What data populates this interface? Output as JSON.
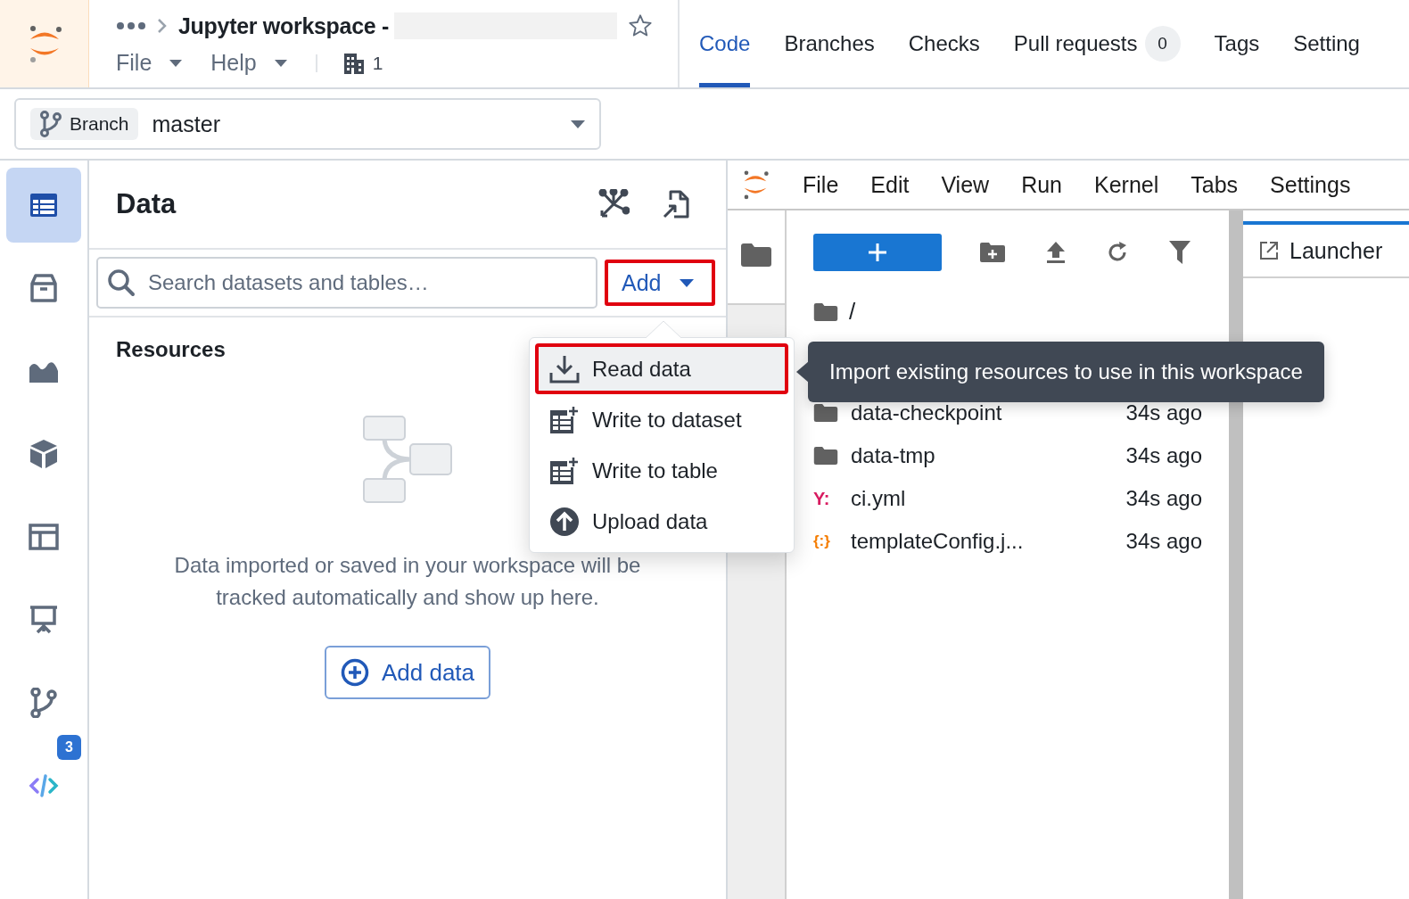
{
  "header": {
    "title": "Jupyter workspace -",
    "starred": false,
    "menus": [
      "File",
      "Help"
    ],
    "building_count": "1"
  },
  "repo_tabs": [
    {
      "label": "Code",
      "selected": true
    },
    {
      "label": "Branches",
      "selected": false
    },
    {
      "label": "Checks",
      "selected": false
    },
    {
      "label": "Pull requests",
      "count": "0",
      "selected": false
    },
    {
      "label": "Tags",
      "selected": false
    },
    {
      "label": "Setting",
      "selected": false
    }
  ],
  "branch": {
    "label": "Branch",
    "value": "master"
  },
  "sidebar": [
    {
      "kind": "table",
      "selected": true
    },
    {
      "kind": "box",
      "selected": false
    },
    {
      "kind": "area",
      "selected": false
    },
    {
      "kind": "cube",
      "selected": false
    },
    {
      "kind": "layout",
      "selected": false
    },
    {
      "kind": "presentation",
      "selected": false
    },
    {
      "kind": "branch",
      "selected": false,
      "badge": "3"
    },
    {
      "kind": "code",
      "selected": false
    }
  ],
  "data_panel": {
    "title": "Data",
    "search": {
      "placeholder": "Search datasets and tables…"
    },
    "add_button": {
      "label": "Add",
      "highlighted": true
    },
    "section": "Resources",
    "empty_message": "Data imported or saved in your workspace will be tracked automatically and show up here.",
    "add_data_button": "Add data"
  },
  "add_menu": [
    {
      "kind": "download",
      "label": "Read data",
      "highlighted": true
    },
    {
      "kind": "table-add",
      "label": "Write to dataset",
      "highlighted": false
    },
    {
      "kind": "table-add",
      "label": "Write to table",
      "highlighted": false
    },
    {
      "kind": "upload",
      "label": "Upload data",
      "highlighted": false
    }
  ],
  "tooltip": "Import existing resources to use in this workspace",
  "jupyter": {
    "menus": [
      "File",
      "Edit",
      "View",
      "Run",
      "Kernel",
      "Tabs",
      "Settings"
    ],
    "path": "/",
    "files": [
      {
        "kind": "folder",
        "name": "data-checkpoint",
        "modified": "34s ago"
      },
      {
        "kind": "folder",
        "name": "data-tmp",
        "modified": "34s ago"
      },
      {
        "kind": "yaml",
        "icon_text": "Y:",
        "name": "ci.yml",
        "modified": "34s ago"
      },
      {
        "kind": "json",
        "icon_text": "{:}",
        "name": "templateConfig.j...",
        "modified": "34s ago"
      }
    ],
    "launcher_tab": {
      "label": "Launcher",
      "selected": true
    }
  }
}
